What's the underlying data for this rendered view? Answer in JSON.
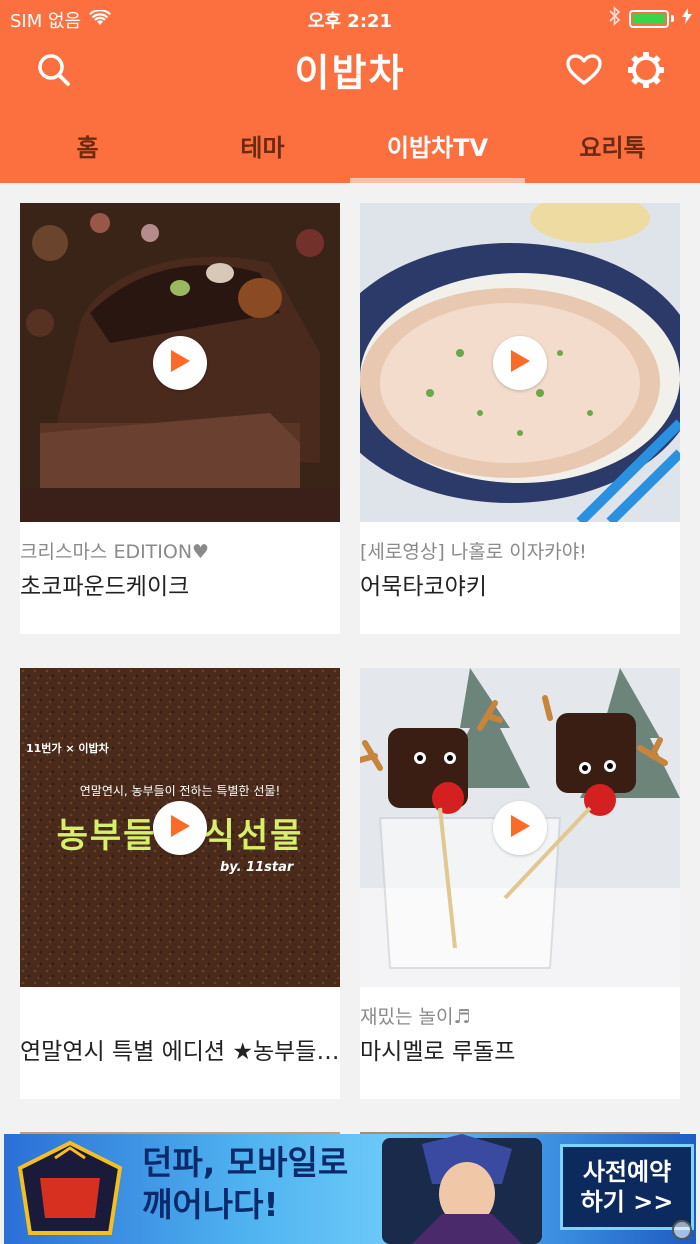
{
  "status_bar": {
    "carrier": "SIM 없음",
    "time": "오후 2:21",
    "battery_color": "#3cd24a",
    "battery_level": 1.0
  },
  "navbar": {
    "app_name": "이밥차",
    "icons": [
      "search-icon",
      "heart-icon",
      "gear-icon"
    ],
    "background_color": "#fc7040"
  },
  "tabs": [
    {
      "label": "홈",
      "active": false
    },
    {
      "label": "테마",
      "active": false
    },
    {
      "label": "이밥차TV",
      "active": true
    },
    {
      "label": "요리톡",
      "active": false
    }
  ],
  "cards": [
    {
      "subtitle": "크리스마스 EDITION♥",
      "title": "초코파운드케이크"
    },
    {
      "subtitle": "[세로영상] 나홀로 이자카야!",
      "title": "어묵타코야키"
    },
    {
      "subtitle": "",
      "title": "연말연시 특별 에디션 ★농부들이 전하는 특별한 선물"
    },
    {
      "subtitle": "재밌는 놀이♬",
      "title": "마시멜로 루돌프"
    }
  ],
  "card3_image_text": {
    "brand": "11번가 × 이밥차",
    "tagline": "연말연시, 농부들이 전하는 특별한 선물!",
    "big_text": "농부들의 식선물",
    "byline": "by. 11star"
  },
  "ad": {
    "headline_line1": "던파, 모바일로",
    "headline_line2": "깨어나다!",
    "cta_line1": "사전예약",
    "cta_line2": "하기 >>"
  }
}
